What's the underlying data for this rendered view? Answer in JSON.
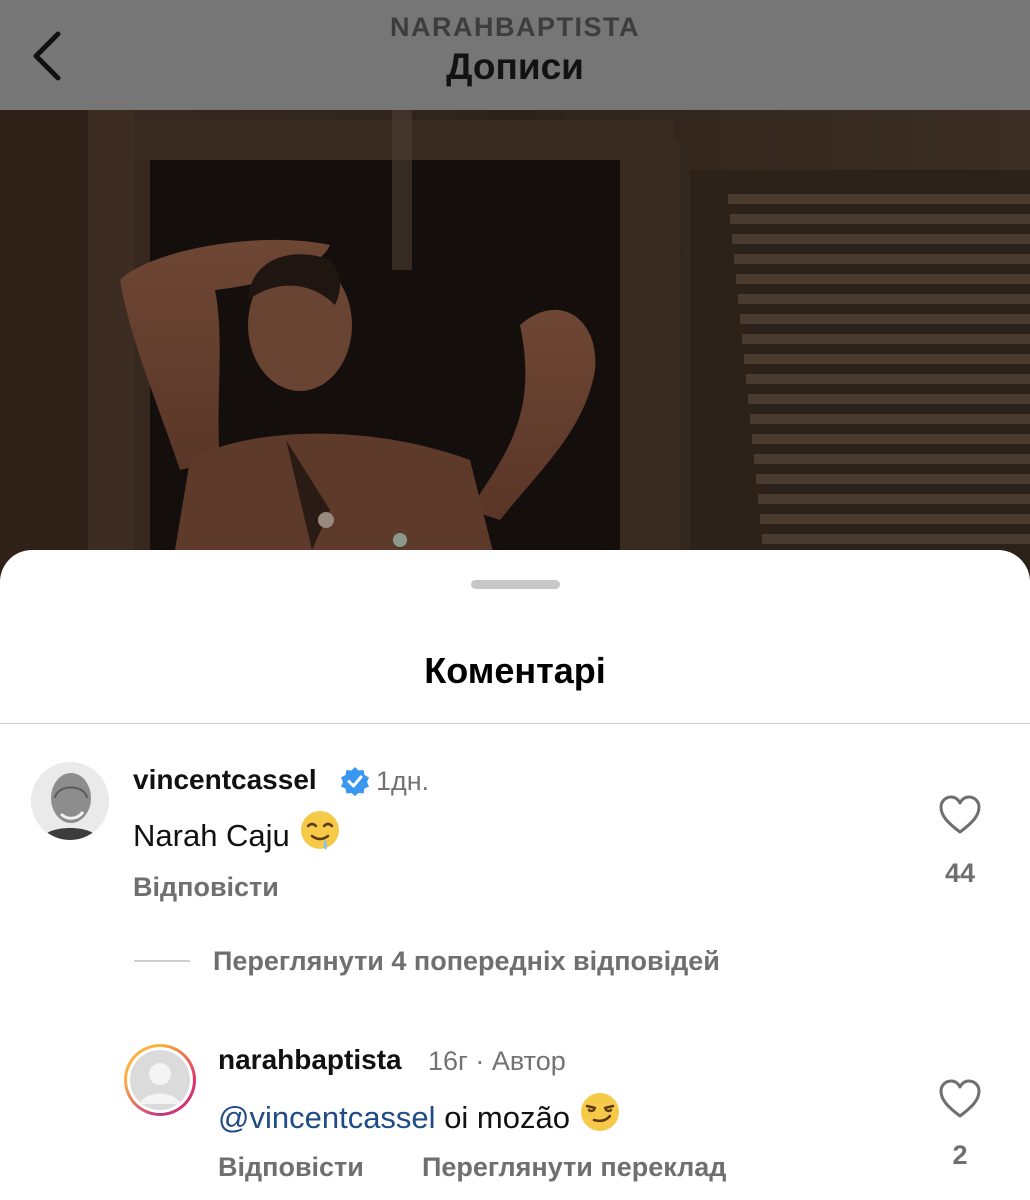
{
  "header": {
    "account": "NARAHBAPTISTA",
    "title": "Дописи",
    "back_icon": "chevron-left-icon"
  },
  "sheet": {
    "title": "Коментарі"
  },
  "comments": [
    {
      "username": "vincentcassel",
      "verified": true,
      "time": "1дн.",
      "text": "Narah Caju",
      "emoji": "drooling-face-emoji",
      "reply_label": "Відповісти",
      "likes": "44"
    }
  ],
  "view_replies_label": "Переглянути 4 попередніх відповідей",
  "reply": {
    "username": "narahbaptista",
    "time": "16г",
    "separator": "·",
    "author_badge": "Автор",
    "mention": "@vincentcassel",
    "text": "oi mozão",
    "emoji": "smirking-face-emoji",
    "reply_label": "Відповісти",
    "translate_label": "Переглянути переклад",
    "likes": "2"
  },
  "colors": {
    "overlay": "#767676",
    "verified": "#3897f0",
    "mention": "#1f4b86",
    "secondary_text": "#737373"
  }
}
